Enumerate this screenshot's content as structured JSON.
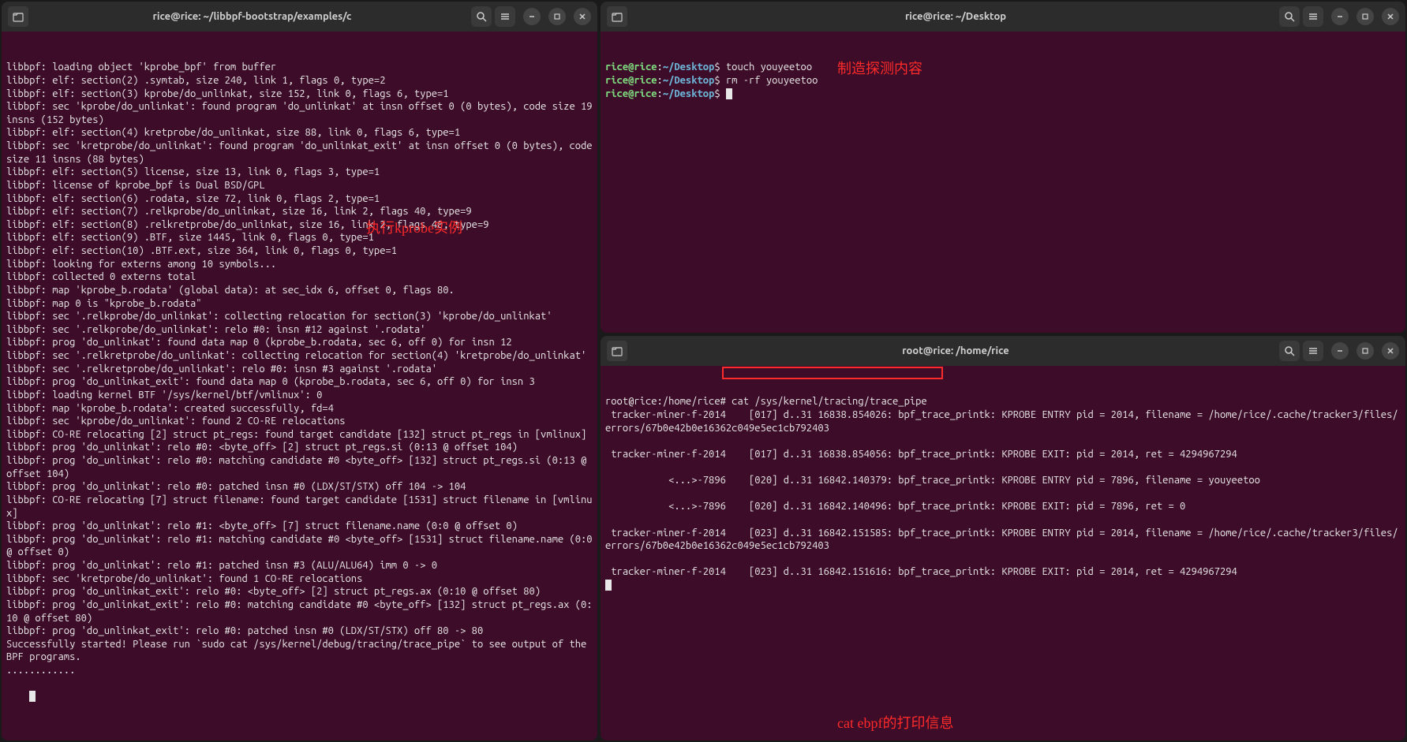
{
  "left_terminal": {
    "title": "rice@rice: ~/libbpf-bootstrap/examples/c",
    "annotation": "执行kprobe实例",
    "lines": [
      "libbpf: loading object 'kprobe_bpf' from buffer",
      "libbpf: elf: section(2) .symtab, size 240, link 1, flags 0, type=2",
      "libbpf: elf: section(3) kprobe/do_unlinkat, size 152, link 0, flags 6, type=1",
      "libbpf: sec 'kprobe/do_unlinkat': found program 'do_unlinkat' at insn offset 0 (0 bytes), code size 19 insns (152 bytes)",
      "libbpf: elf: section(4) kretprobe/do_unlinkat, size 88, link 0, flags 6, type=1",
      "libbpf: sec 'kretprobe/do_unlinkat': found program 'do_unlinkat_exit' at insn offset 0 (0 bytes), code size 11 insns (88 bytes)",
      "libbpf: elf: section(5) license, size 13, link 0, flags 3, type=1",
      "libbpf: license of kprobe_bpf is Dual BSD/GPL",
      "libbpf: elf: section(6) .rodata, size 72, link 0, flags 2, type=1",
      "libbpf: elf: section(7) .relkprobe/do_unlinkat, size 16, link 2, flags 40, type=9",
      "libbpf: elf: section(8) .relkretprobe/do_unlinkat, size 16, link 2, flags 40, type=9",
      "libbpf: elf: section(9) .BTF, size 1445, link 0, flags 0, type=1",
      "libbpf: elf: section(10) .BTF.ext, size 364, link 0, flags 0, type=1",
      "libbpf: looking for externs among 10 symbols...",
      "libbpf: collected 0 externs total",
      "libbpf: map 'kprobe_b.rodata' (global data): at sec_idx 6, offset 0, flags 80.",
      "libbpf: map 0 is \"kprobe_b.rodata\"",
      "libbpf: sec '.relkprobe/do_unlinkat': collecting relocation for section(3) 'kprobe/do_unlinkat'",
      "libbpf: sec '.relkprobe/do_unlinkat': relo #0: insn #12 against '.rodata'",
      "libbpf: prog 'do_unlinkat': found data map 0 (kprobe_b.rodata, sec 6, off 0) for insn 12",
      "libbpf: sec '.relkretprobe/do_unlinkat': collecting relocation for section(4) 'kretprobe/do_unlinkat'",
      "libbpf: sec '.relkretprobe/do_unlinkat': relo #0: insn #3 against '.rodata'",
      "libbpf: prog 'do_unlinkat_exit': found data map 0 (kprobe_b.rodata, sec 6, off 0) for insn 3",
      "libbpf: loading kernel BTF '/sys/kernel/btf/vmlinux': 0",
      "libbpf: map 'kprobe_b.rodata': created successfully, fd=4",
      "libbpf: sec 'kprobe/do_unlinkat': found 2 CO-RE relocations",
      "libbpf: CO-RE relocating [2] struct pt_regs: found target candidate [132] struct pt_regs in [vmlinux]",
      "libbpf: prog 'do_unlinkat': relo #0: <byte_off> [2] struct pt_regs.si (0:13 @ offset 104)",
      "libbpf: prog 'do_unlinkat': relo #0: matching candidate #0 <byte_off> [132] struct pt_regs.si (0:13 @ offset 104)",
      "libbpf: prog 'do_unlinkat': relo #0: patched insn #0 (LDX/ST/STX) off 104 -> 104",
      "libbpf: CO-RE relocating [7] struct filename: found target candidate [1531] struct filename in [vmlinux]",
      "libbpf: prog 'do_unlinkat': relo #1: <byte_off> [7] struct filename.name (0:0 @ offset 0)",
      "libbpf: prog 'do_unlinkat': relo #1: matching candidate #0 <byte_off> [1531] struct filename.name (0:0 @ offset 0)",
      "libbpf: prog 'do_unlinkat': relo #1: patched insn #3 (ALU/ALU64) imm 0 -> 0",
      "libbpf: sec 'kretprobe/do_unlinkat': found 1 CO-RE relocations",
      "libbpf: prog 'do_unlinkat_exit': relo #0: <byte_off> [2] struct pt_regs.ax (0:10 @ offset 80)",
      "libbpf: prog 'do_unlinkat_exit': relo #0: matching candidate #0 <byte_off> [132] struct pt_regs.ax (0:10 @ offset 80)",
      "libbpf: prog 'do_unlinkat_exit': relo #0: patched insn #0 (LDX/ST/STX) off 80 -> 80",
      "Successfully started! Please run `sudo cat /sys/kernel/debug/tracing/trace_pipe` to see output of the BPF programs.",
      "............"
    ]
  },
  "top_right_terminal": {
    "title": "rice@rice: ~/Desktop",
    "annotation": "制造探测内容",
    "prompt": {
      "user": "rice",
      "host": "rice",
      "path": "~/Desktop",
      "symbol": "$"
    },
    "commands": [
      "touch youyeetoo",
      "rm -rf youyeetoo",
      ""
    ]
  },
  "bottom_right_terminal": {
    "title": "root@rice: /home/rice",
    "annotation": "cat ebpf的打印信息",
    "prompt_line": {
      "user_host": "root@rice",
      "path": "/home/rice",
      "symbol": "#",
      "command": "cat /sys/kernel/tracing/trace_pipe"
    },
    "output": [
      " tracker-miner-f-2014    [017] d..31 16838.854026: bpf_trace_printk: KPROBE ENTRY pid = 2014, filename = /home/rice/.cache/tracker3/files/errors/67b0e42b0e16362c049e5ec1cb792403",
      "",
      " tracker-miner-f-2014    [017] d..31 16838.854056: bpf_trace_printk: KPROBE EXIT: pid = 2014, ret = 4294967294",
      "",
      "           <...>-7896    [020] d..31 16842.140379: bpf_trace_printk: KPROBE ENTRY pid = 7896, filename = youyeetoo",
      "",
      "           <...>-7896    [020] d..31 16842.140496: bpf_trace_printk: KPROBE EXIT: pid = 7896, ret = 0",
      "",
      " tracker-miner-f-2014    [023] d..31 16842.151585: bpf_trace_printk: KPROBE ENTRY pid = 2014, filename = /home/rice/.cache/tracker3/files/errors/67b0e42b0e16362c049e5ec1cb792403",
      "",
      " tracker-miner-f-2014    [023] d..31 16842.151616: bpf_trace_printk: KPROBE EXIT: pid = 2014, ret = 4294967294"
    ]
  }
}
